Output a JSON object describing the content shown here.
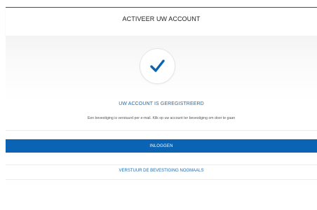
{
  "header": {
    "title": "ACTIVEER UW ACCOUNT"
  },
  "confirmation": {
    "icon": "checkmark-icon",
    "title": "UW ACCOUNT IS GEREGISTREERD",
    "message": "Een bevestiging is verstuurd per e-mail. Klik op uw account ter bevestiging om door te gaan"
  },
  "actions": {
    "login_label": "INLOGGEN",
    "resend_label": "VERSTUUR DE BEVESTIGING NOGMAALS"
  },
  "colors": {
    "accent": "#0b63b3",
    "accent_text": "#1f6bb0",
    "top_rule": "#4d4d4d"
  }
}
